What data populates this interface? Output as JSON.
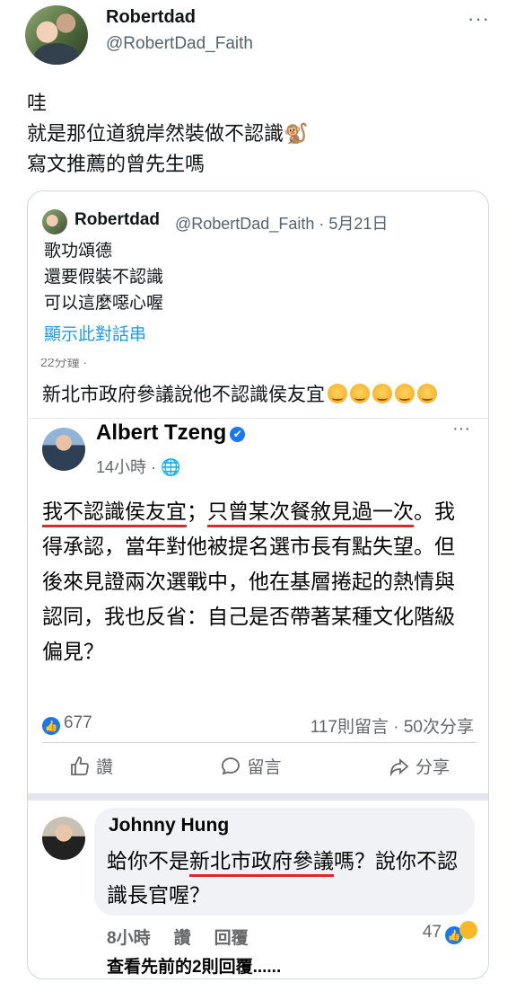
{
  "tweet": {
    "display_name": "Robertdad",
    "handle": "@RobertDad_Faith",
    "more_label": "···",
    "lines": [
      "哇",
      "就是那位道貌岸然裝做不認識🐒",
      "寫文推薦的曾先生嗎"
    ]
  },
  "quote": {
    "display_name": "Robertdad",
    "meta": "@RobertDad_Faith · 5月21日",
    "lines": [
      "歌功頌德",
      "還要假裝不認識",
      "可以這麼噁心喔"
    ],
    "thread_link": "顯示此對話串",
    "embedded": {
      "cut_text": "22分鐘 · ",
      "top_comment": "新北市政府參議說他不認識侯友宜",
      "post": {
        "author": "Albert Tzeng",
        "verified": "✔",
        "time": "14小時 · 🌐",
        "more": "···",
        "u1": "我不認識侯友宜",
        "sep": "；",
        "u2": "只曾某次餐敘見過一次",
        "tail": "。我得承認，當年對他被提名選市長有點失望。但後來見證兩次選戰中，他在基層捲起的熱情與認同，我也反省：自己是否帶著某種文化階級偏見？",
        "like_count": "677",
        "counts": "117則留言 · 50次分享",
        "actions": [
          "讚",
          "留言",
          "分享"
        ]
      },
      "comment": {
        "author": "Johnny Hung",
        "pre": "蛤你不是",
        "underlined": "新北市政府參議",
        "post": "嗎？說你不認識長官喔？",
        "time": "8小時",
        "like": "讚",
        "reply": "回覆",
        "reaction_count": "47",
        "view_more": "查看先前的2則回覆......"
      }
    }
  },
  "colors": {
    "link": "#1d9bf0",
    "fb_blue": "#1877f2",
    "underline": "#d92b2b"
  }
}
